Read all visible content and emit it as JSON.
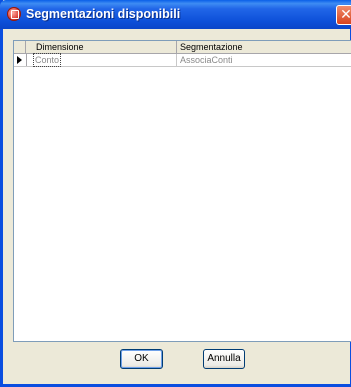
{
  "window": {
    "title": "Segmentazioni disponibili",
    "close_glyph": "✕"
  },
  "grid": {
    "columns": [
      "Dimensione",
      "Segmentazione"
    ],
    "rows": [
      {
        "dimensione": "Conto",
        "segmentazione": "AssociaConti"
      }
    ]
  },
  "buttons": {
    "ok_label": "OK",
    "cancel_label": "Annulla"
  },
  "colors": {
    "titlebar": "#0A5FE8",
    "close": "#D8431E",
    "background": "#ECE9D8"
  }
}
